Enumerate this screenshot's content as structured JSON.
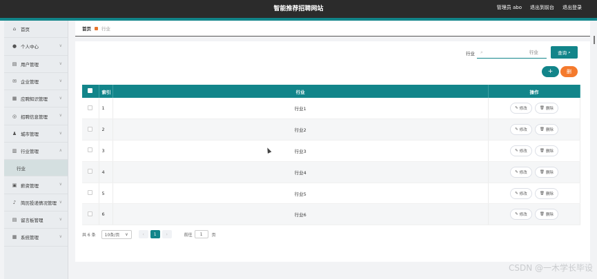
{
  "header": {
    "title": "智能推荐招聘网站",
    "admin_label": "管理员 abo",
    "back_label": "退出到前台",
    "logout_label": "退出登录"
  },
  "sidebar": {
    "items": [
      {
        "label": "首页",
        "icon": "home-icon",
        "glyph": "⌂"
      },
      {
        "label": "个人中心",
        "icon": "user-icon",
        "glyph": "●"
      },
      {
        "label": "用户管理",
        "icon": "users-icon",
        "glyph": "▤"
      },
      {
        "label": "企业管理",
        "icon": "mail-icon",
        "glyph": "✉"
      },
      {
        "label": "应聘知识管理",
        "icon": "book-icon",
        "glyph": "▦"
      },
      {
        "label": "招聘信息管理",
        "icon": "target-icon",
        "glyph": "◎"
      },
      {
        "label": "城市管理",
        "icon": "person-icon",
        "glyph": "♟"
      },
      {
        "label": "行业管理",
        "icon": "doc-icon",
        "glyph": "▥"
      }
    ],
    "active_sub": "行业",
    "items_after": [
      {
        "label": "薪资管理",
        "icon": "wallet-icon",
        "glyph": "▣"
      },
      {
        "label": "简历投递情况管理",
        "icon": "mic-icon",
        "glyph": "♪"
      },
      {
        "label": "留言板管理",
        "icon": "board-icon",
        "glyph": "▤"
      },
      {
        "label": "系统管理",
        "icon": "settings-icon",
        "glyph": "▦"
      }
    ]
  },
  "breadcrumb": {
    "home": "首页",
    "current": "行业"
  },
  "search": {
    "label": "行业",
    "placeholder": "行业",
    "button_label": "查询"
  },
  "actions": {
    "add_label": "+",
    "delete_label": "删"
  },
  "table": {
    "headers": {
      "index": "索引",
      "name": "行业",
      "ops": "操作"
    },
    "rows": [
      {
        "index": "1",
        "name": "行业1"
      },
      {
        "index": "2",
        "name": "行业2"
      },
      {
        "index": "3",
        "name": "行业3"
      },
      {
        "index": "4",
        "name": "行业4"
      },
      {
        "index": "5",
        "name": "行业5"
      },
      {
        "index": "6",
        "name": "行业6"
      }
    ],
    "edit_label": "修改",
    "delete_label": "删除"
  },
  "pagination": {
    "total": "共 6 条",
    "page_size": "10条/页",
    "current_page": "1",
    "goto_label": "前往",
    "goto_value": "1",
    "unit": "页"
  },
  "watermark": "CSDN @一木学长毕设",
  "colors": {
    "primary": "#12858a",
    "danger": "#f47a2d",
    "topbar": "#2b2b2b"
  }
}
